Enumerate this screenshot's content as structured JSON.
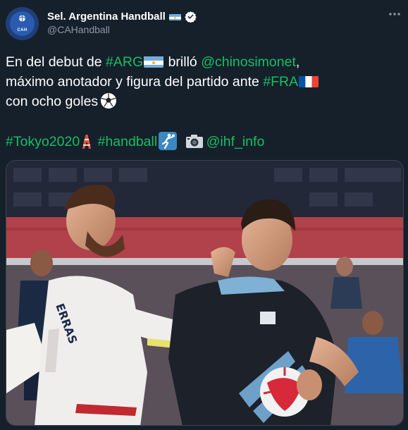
{
  "author": {
    "name": "Sel. Argentina Handball",
    "handle": "@CAHandball",
    "avatar_text": "CAH"
  },
  "tweet": {
    "line1": {
      "t1": "En del debut de ",
      "tag_arg": "#ARG",
      "t2": " brilló ",
      "mention_player": "@chinosimonet",
      "t3": ","
    },
    "line2": {
      "t1": "máximo anotador y figura del partido ante ",
      "tag_fra": "#FRA"
    },
    "line3": {
      "t1": "con ocho goles"
    },
    "line5": {
      "tag_tokyo": "#Tokyo2020",
      "tag_handball": "#handball",
      "mention_ihf": "@ihf_info"
    }
  },
  "colors": {
    "background": "#15202b",
    "link": "#1d9bf0",
    "hashtag_green": "#17bf63",
    "secondary_text": "#8b98a5"
  },
  "icons": {
    "verified": "verified-badge-icon",
    "more": "more-options-icon",
    "ball": "soccer-ball-icon",
    "tower": "tokyo-tower-icon",
    "handball": "handball-player-icon",
    "camera": "camera-icon"
  }
}
